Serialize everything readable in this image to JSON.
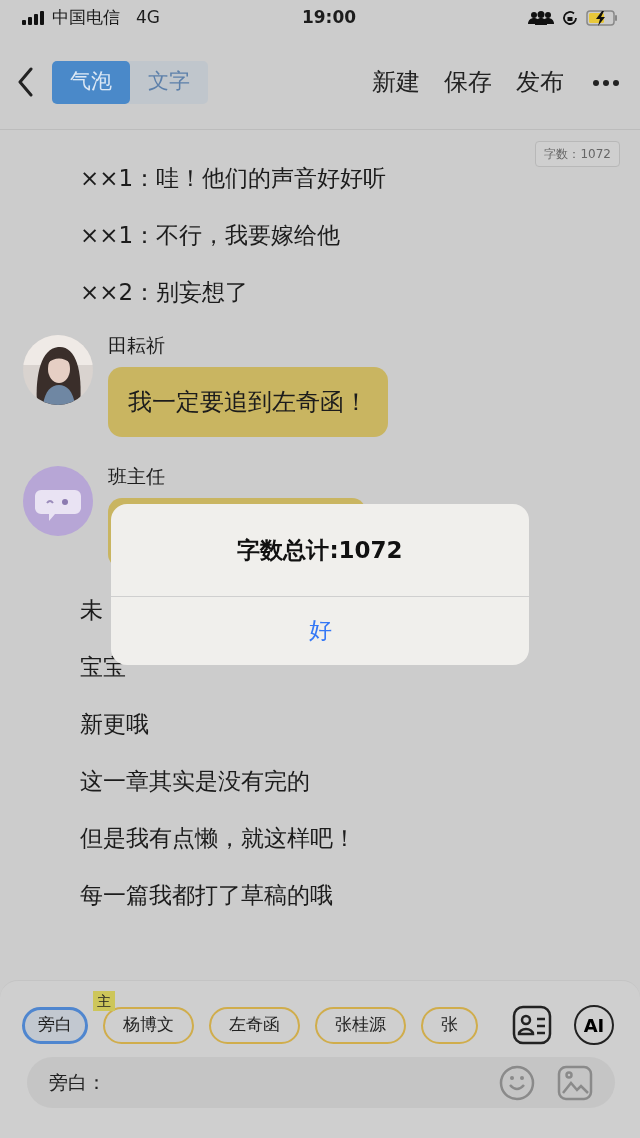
{
  "status_bar": {
    "carrier": "中国电信",
    "network": "4G",
    "time": "19:00"
  },
  "header": {
    "modes": [
      {
        "label": "气泡",
        "selected": true
      },
      {
        "label": "文字",
        "selected": false
      }
    ],
    "actions": [
      "新建",
      "保存",
      "发布"
    ]
  },
  "word_count": "字数：1072",
  "script": [
    {
      "kind": "narration",
      "text": "××1：哇！他们的声音好好听"
    },
    {
      "kind": "narration",
      "text": "××1：不行，我要嫁给他"
    },
    {
      "kind": "narration",
      "text": "××2：别妄想了"
    },
    {
      "kind": "message",
      "speaker": "田耘祈",
      "text": "我一定要追到左奇函！"
    },
    {
      "kind": "message",
      "speaker": "班主任",
      "avatar": {
        "kind": "icon"
      }
    },
    {
      "kind": "narration",
      "text": "未"
    },
    {
      "kind": "narration",
      "text": "宝宝"
    },
    {
      "kind": "narration",
      "text": "新更哦"
    },
    {
      "kind": "narration",
      "text": "这一章其实是没有完的"
    },
    {
      "kind": "narration",
      "text": "但是我有点懒，就这样吧！"
    },
    {
      "kind": "narration",
      "text": "每一篇我都打了草稿的哦"
    }
  ],
  "alert": {
    "message": "字数总计:1072",
    "button": "好"
  },
  "roles": [
    {
      "label": "旁白",
      "selected": true
    },
    {
      "label": "杨博文",
      "selected": false,
      "tag": "主"
    },
    {
      "label": "左奇函",
      "selected": false
    },
    {
      "label": "张桂源",
      "selected": false
    },
    {
      "label": "张",
      "selected": false
    }
  ],
  "ai_button": "AI",
  "composer": {
    "prefix": "旁白："
  }
}
